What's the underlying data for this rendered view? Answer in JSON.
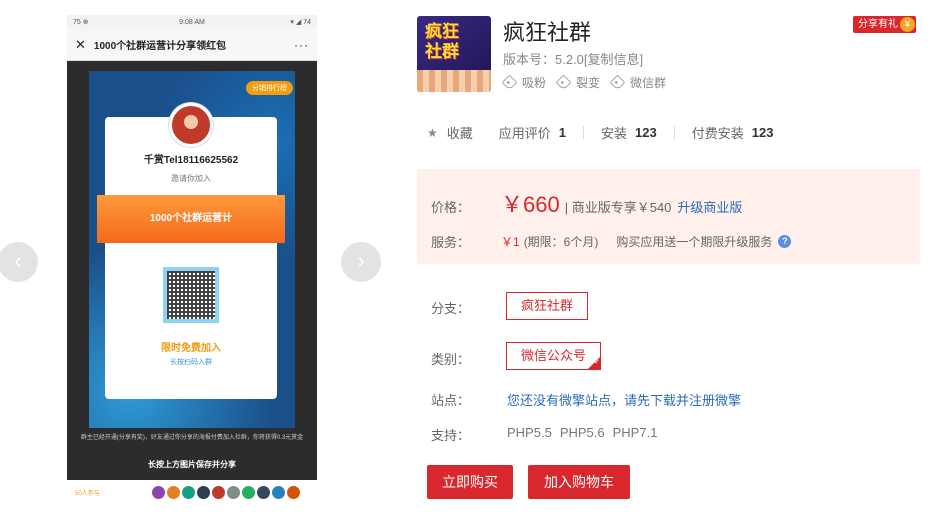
{
  "gallery": {
    "prev_arrow": "‹",
    "next_arrow": "›",
    "phone": {
      "status_left": "75 ⊕",
      "status_time": "9:08 AM",
      "status_right": "▾ ◢ 74",
      "close_glyph": "✕",
      "header_title": "1000个社群运营计分享领红包",
      "more_glyph": "···",
      "rank_badge": "分销排行榜",
      "inviter": "千赏Tel18116625562",
      "invite_text": "邀请你加入",
      "band_title": "1000个社群运营计",
      "free_join": "限时免费加入",
      "scan_join": "长按扫码入群",
      "footer_text": "群主已经开通(分享有奖)，好友通过你分享的海报付费加入社群，你将获得0.3元赏金",
      "save_tip": "长按上方图片保存并分享",
      "joined_count": "50人参与"
    }
  },
  "app": {
    "icon_text_line1": "疯狂",
    "icon_text_line2": "社群",
    "title": "疯狂社群",
    "gift_badge": "分享有礼",
    "gift_icon": "¥",
    "version": "版本号：5.2.0[复制信息]",
    "tags": [
      "吸粉",
      "裂变",
      "微信群"
    ]
  },
  "stats": {
    "favorite": "收藏",
    "rating_label": "应用评价",
    "rating_value": "1",
    "install_label": "安装",
    "install_value": "123",
    "paid_install_label": "付费安装",
    "paid_install_value": "123"
  },
  "pricing": {
    "price_label": "价格：",
    "price": "￥660",
    "business_text": "| 商业版专享￥540",
    "upgrade_link": "升级商业版",
    "service_label": "服务：",
    "service_price": "￥1",
    "service_period": "(期限：6个月)",
    "service_desc": "购买应用送一个期限升级服务",
    "help_icon": "?"
  },
  "options": {
    "branch_label": "分支：",
    "branch_value": "疯狂社群",
    "category_label": "类别：",
    "category_value": "微信公众号",
    "site_label": "站点：",
    "site_link": "您还没有微擎站点，请先下载并注册微擎",
    "support_label": "支持：",
    "php_versions": [
      "PHP5.5",
      "PHP5.6",
      "PHP7.1"
    ]
  },
  "actions": {
    "buy_now": "立即购买",
    "add_to_cart": "加入购物车"
  },
  "colors": {
    "accent_red": "#d9272e",
    "link_blue": "#2b6cb8",
    "price_bg": "#fff0ec"
  }
}
